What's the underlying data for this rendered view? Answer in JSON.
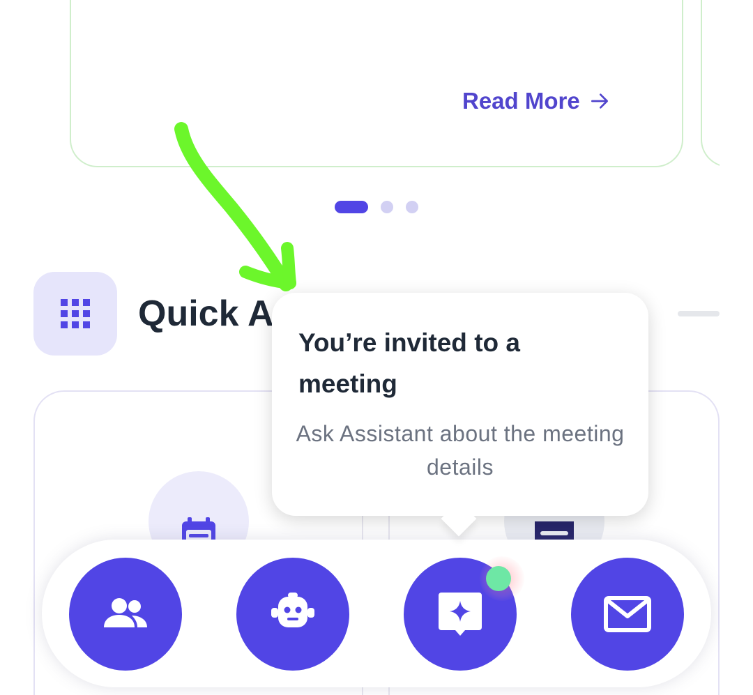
{
  "card": {
    "read_more_label": "Read More"
  },
  "pager": {
    "total": 3,
    "active_index": 0
  },
  "quick_access": {
    "title": "Quick Ac"
  },
  "tooltip": {
    "title": "You’re invited to a meeting",
    "subtitle": "Ask Assistant about the meeting details"
  },
  "bottom_nav": {
    "items": [
      {
        "icon": "people-icon"
      },
      {
        "icon": "robot-icon"
      },
      {
        "icon": "assistant-sparkle-icon",
        "badge": true
      },
      {
        "icon": "mail-icon"
      }
    ]
  },
  "colors": {
    "accent": "#5145e5",
    "card_border": "#cfeecb",
    "badge": "#6ee7a5",
    "annotation": "#6cf62b"
  }
}
